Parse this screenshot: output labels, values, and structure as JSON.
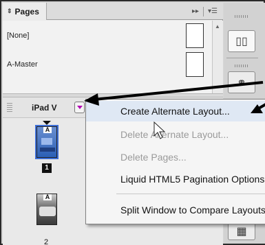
{
  "panel": {
    "tab_label": "Pages",
    "tab_arrows_icon": "double-triangle-icon",
    "masters": [
      {
        "label": "[None]"
      },
      {
        "label": "A-Master"
      }
    ],
    "layout": {
      "name": "iPad V"
    },
    "pages": [
      {
        "master_label": "A",
        "number": "1",
        "selected": true
      },
      {
        "master_label": "A",
        "number": "2",
        "selected": false
      }
    ]
  },
  "context_menu": {
    "items": [
      {
        "label": "Create Alternate Layout...",
        "enabled": true,
        "highlighted": true
      },
      {
        "label": "Delete Alternate Layout...",
        "enabled": false
      },
      {
        "label": "Delete Pages...",
        "enabled": false
      },
      {
        "label": "Liquid HTML5 Pagination Options...",
        "enabled": true
      },
      {
        "label": "Split Window to Compare Layouts",
        "enabled": true
      }
    ]
  },
  "colors": {
    "menu_highlight": "#dfe8f4",
    "menu_button_arrow": "#b300b3",
    "selected_page": "#3d6ed6",
    "annotation_arrow": "#000000"
  }
}
